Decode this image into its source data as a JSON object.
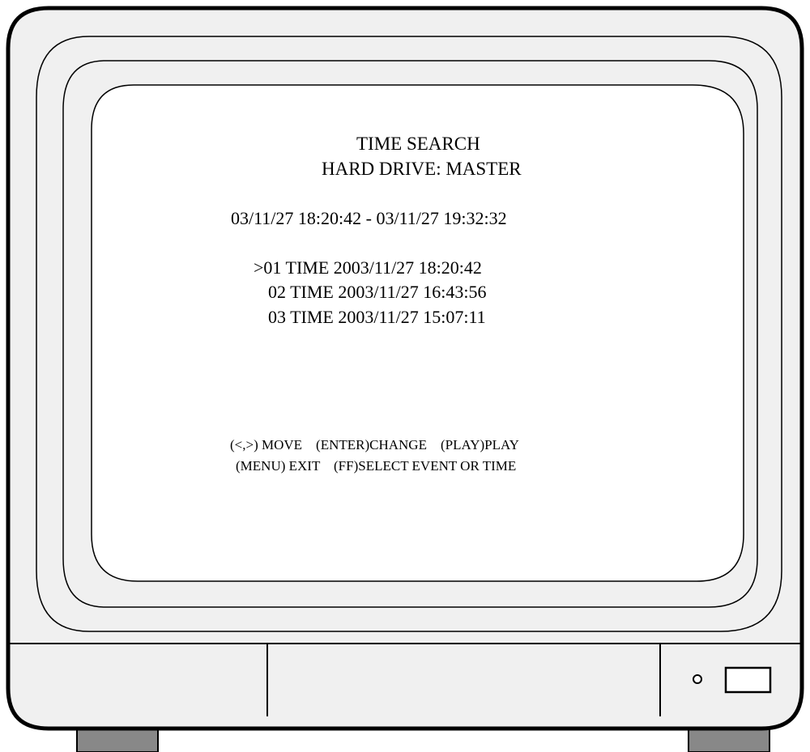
{
  "menu": {
    "title": "TIME SEARCH",
    "drive": "HARD DRIVE: MASTER",
    "range": "03/11/27 18:20:42 - 03/11/27 19:32:32",
    "items": [
      {
        "label": ">01 TIME 2003/11/27 18:20:42",
        "selected": true
      },
      {
        "label": "02 TIME 2003/11/27 16:43:56",
        "selected": false
      },
      {
        "label": "03 TIME 2003/11/27 15:07:11",
        "selected": false
      }
    ],
    "help": [
      "(<,>) MOVE    (ENTER)CHANGE    (PLAY)PLAY",
      "(MENU) EXIT    (FF)SELECT EVENT OR TIME"
    ]
  },
  "colors": {
    "bezel": "#f0f0f0",
    "screen": "#ffffff",
    "feet": "#888888",
    "outline": "#000000"
  },
  "icons": {
    "power_led": "circle",
    "front_slot": "rectangle"
  }
}
